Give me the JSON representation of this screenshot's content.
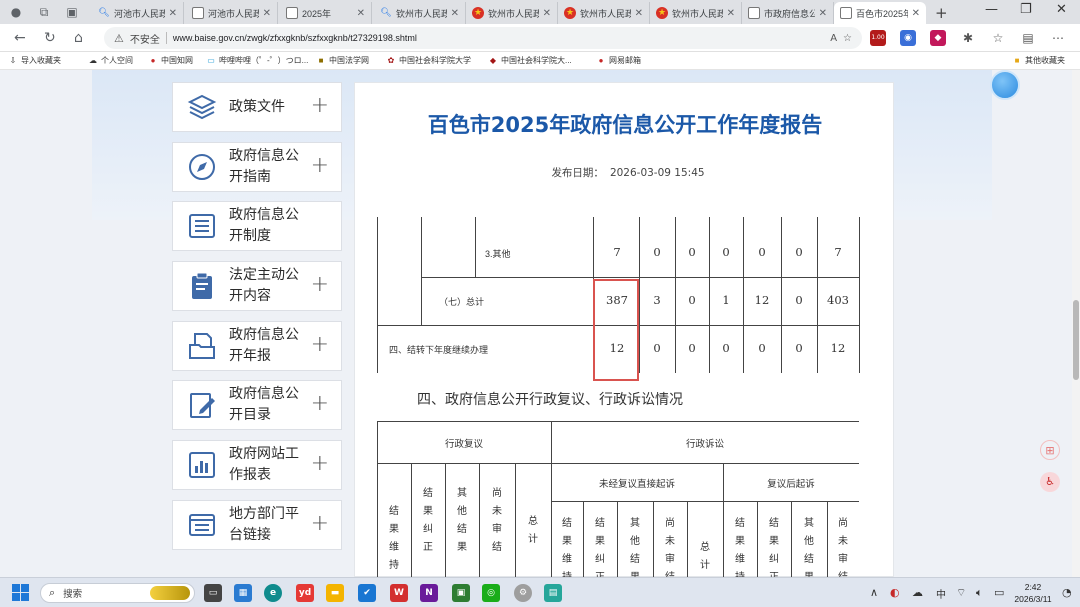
{
  "browser": {
    "tabs": [
      {
        "title": "河池市人民政",
        "icon": "search-icon"
      },
      {
        "title": "河池市人民政",
        "icon": "document-icon"
      },
      {
        "title": "2025年",
        "icon": "document-icon"
      },
      {
        "title": "钦州市人民政",
        "icon": "search-icon"
      },
      {
        "title": "钦州市人民政",
        "icon": "emblem-icon"
      },
      {
        "title": "钦州市人民政",
        "icon": "emblem-icon"
      },
      {
        "title": "钦州市人民政",
        "icon": "emblem-icon"
      },
      {
        "title": "市政府信息公",
        "icon": "document-icon"
      },
      {
        "title": "百色市2025年",
        "icon": "document-icon",
        "active": true
      }
    ],
    "address": {
      "security_label": "不安全",
      "url": "www.baise.gov.cn/zwgk/zfxxgknb/szfxxgknb/t27329198.shtml"
    },
    "extension_badge": "1.00",
    "bookmarks": [
      {
        "label": "导入收藏夹",
        "icon": "import-icon"
      },
      {
        "label": "个人空间",
        "icon": "cloud-icon"
      },
      {
        "label": "中国知网",
        "icon": "cnki-icon"
      },
      {
        "label": "哔哩哔哩（゜-゜）つロ...",
        "icon": "bilibili-icon"
      },
      {
        "label": "中国法学网",
        "icon": "bookmark-icon"
      },
      {
        "label": "中国社会科学院大学",
        "icon": "ucass-icon"
      },
      {
        "label": "中国社会科学院大...",
        "icon": "cass-icon"
      },
      {
        "label": "网易邮箱",
        "icon": "mail-icon"
      },
      {
        "label": "其他收藏夹",
        "icon": "folder-icon"
      }
    ]
  },
  "sidebar": {
    "items": [
      {
        "label": "政策文件",
        "icon": "stack-icon"
      },
      {
        "label": "政府信息公开指南",
        "icon": "compass-icon"
      },
      {
        "label": "政府信息公开制度",
        "icon": "list-icon"
      },
      {
        "label": "法定主动公开内容",
        "icon": "clipboard-icon"
      },
      {
        "label": "政府信息公开年报",
        "icon": "folder-doc-icon"
      },
      {
        "label": "政府信息公开目录",
        "icon": "edit-doc-icon"
      },
      {
        "label": "政府网站工作报表",
        "icon": "bar-chart-icon"
      },
      {
        "label": "地方部门平台链接",
        "icon": "window-icon"
      }
    ]
  },
  "article": {
    "title": "百色市2025年政府信息公开工作年度报告",
    "date_label": "发布日期：",
    "date_value": "2026-03-09 15:45",
    "table1": {
      "rows": [
        {
          "label": "3.其他",
          "values": [
            "7",
            "0",
            "0",
            "0",
            "0",
            "0",
            "7"
          ]
        },
        {
          "label": "（七）总计",
          "values": [
            "387",
            "3",
            "0",
            "1",
            "12",
            "0",
            "403"
          ]
        },
        {
          "label": "四、结转下年度继续办理",
          "values": [
            "12",
            "0",
            "0",
            "0",
            "0",
            "0",
            "12"
          ]
        }
      ]
    },
    "section4_heading": "四、政府信息公开行政复议、行政诉讼情况",
    "table2": {
      "group_review": "行政复议",
      "group_lawsuit": "行政诉讼",
      "sub_direct": "未经复议直接起诉",
      "sub_after": "复议后起诉",
      "review_cols": [
        "结果维持",
        "结果纠正",
        "其他结果",
        "尚未审结",
        "总计"
      ],
      "direct_cols": [
        "结果维持",
        "结果纠正",
        "其他结果",
        "尚未审结",
        "总计"
      ],
      "after_cols": [
        "结果维持",
        "结果纠正",
        "其他结果",
        "尚未审结"
      ]
    }
  },
  "taskbar": {
    "search_label": "搜索",
    "ime_label": "中",
    "time": "2:42",
    "date": "2026/3/11"
  }
}
